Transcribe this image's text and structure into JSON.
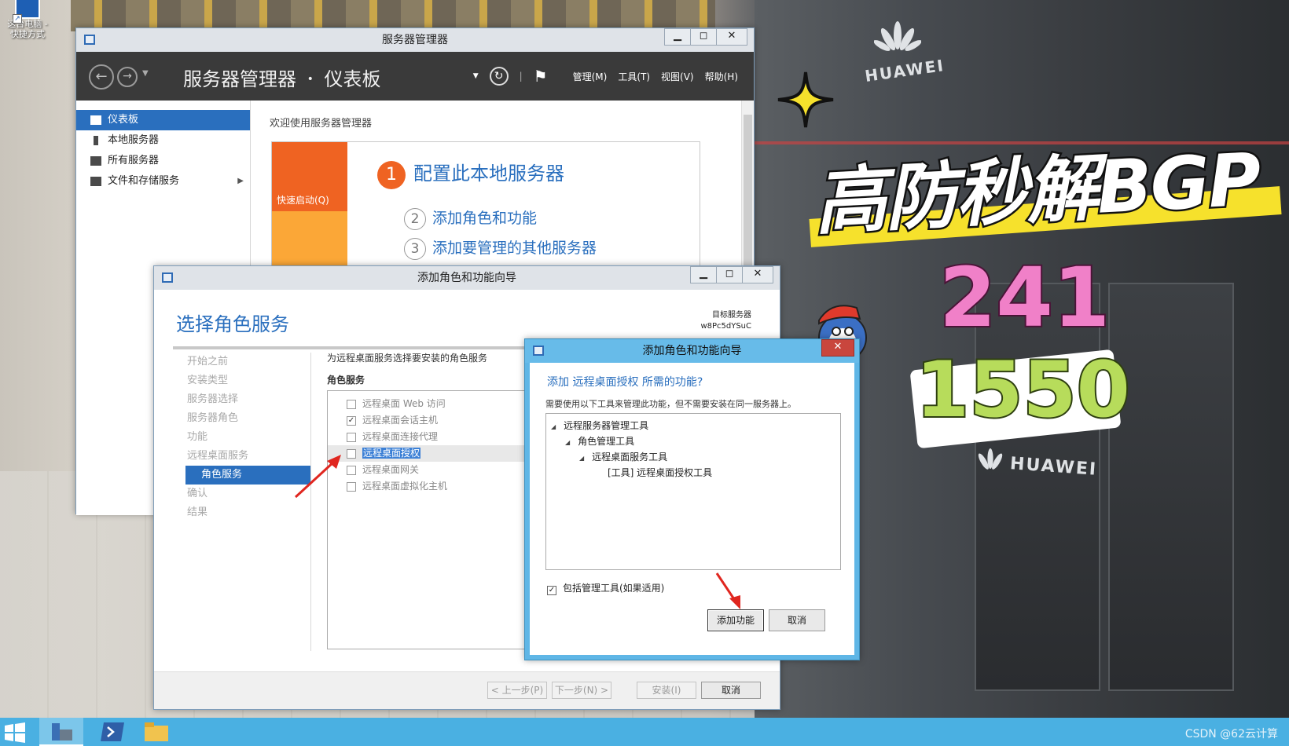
{
  "desktop": {
    "icon_label_1": "这台电脑 -",
    "icon_label_2": "快捷方式"
  },
  "overlay": {
    "headline": "高防秒解BGP",
    "number_1": "241",
    "number_2": "1550",
    "brand": "HUAWEI"
  },
  "server_manager": {
    "window_title": "服务器管理器",
    "breadcrumb_root": "服务器管理器",
    "breadcrumb_sep": "•",
    "breadcrumb_page": "仪表板",
    "menu": [
      "管理(M)",
      "工具(T)",
      "视图(V)",
      "帮助(H)"
    ],
    "nav": [
      {
        "label": "仪表板",
        "selected": true
      },
      {
        "label": "本地服务器"
      },
      {
        "label": "所有服务器"
      },
      {
        "label": "文件和存储服务"
      }
    ],
    "welcome": "欢迎使用服务器管理器",
    "quick_start": "快速启动(Q)",
    "step1_num": "1",
    "step1": "配置此本地服务器",
    "step2_num": "2",
    "step2": "添加角色和功能",
    "step3_num": "3",
    "step3": "添加要管理的其他服务器"
  },
  "wizard": {
    "window_title": "添加角色和功能向导",
    "heading": "选择角色服务",
    "dest_label": "目标服务器",
    "dest_server": "w8Pc5dYSuC",
    "steps": [
      "开始之前",
      "安装类型",
      "服务器选择",
      "服务器角色",
      "功能",
      "远程桌面服务",
      "角色服务",
      "确认",
      "结果"
    ],
    "current_step": "角色服务",
    "description": "为远程桌面服务选择要安装的角色服务",
    "role_services_header": "角色服务",
    "role_services": [
      {
        "label": "远程桌面 Web 访问",
        "checked": false
      },
      {
        "label": "远程桌面会话主机",
        "checked": true
      },
      {
        "label": "远程桌面连接代理",
        "checked": false
      },
      {
        "label": "远程桌面授权",
        "checked": false,
        "highlighted": true
      },
      {
        "label": "远程桌面网关",
        "checked": false
      },
      {
        "label": "远程桌面虚拟化主机",
        "checked": false
      }
    ],
    "btn_prev": "< 上一步(P)",
    "btn_next": "下一步(N) >",
    "btn_install": "安装(I)",
    "btn_cancel": "取消"
  },
  "dialog": {
    "window_title": "添加角色和功能向导",
    "question": "添加 远程桌面授权 所需的功能?",
    "note": "需要使用以下工具来管理此功能，但不需要安装在同一服务器上。",
    "tree": [
      "远程服务器管理工具",
      "角色管理工具",
      "远程桌面服务工具",
      "[工具] 远程桌面授权工具"
    ],
    "include_tools": "包括管理工具(如果适用)",
    "include_checked": true,
    "btn_add": "添加功能",
    "btn_cancel": "取消"
  },
  "taskbar": {
    "watermark": "CSDN @62云计算"
  },
  "colors": {
    "accent_blue": "#2a6fbe",
    "quickstart_orange": "#ef6322",
    "quickstart_yellow": "#fba737",
    "dialog_frame": "#5fb6e6",
    "taskbar": "#4ab0e2",
    "annotation_red": "#e0261f"
  }
}
